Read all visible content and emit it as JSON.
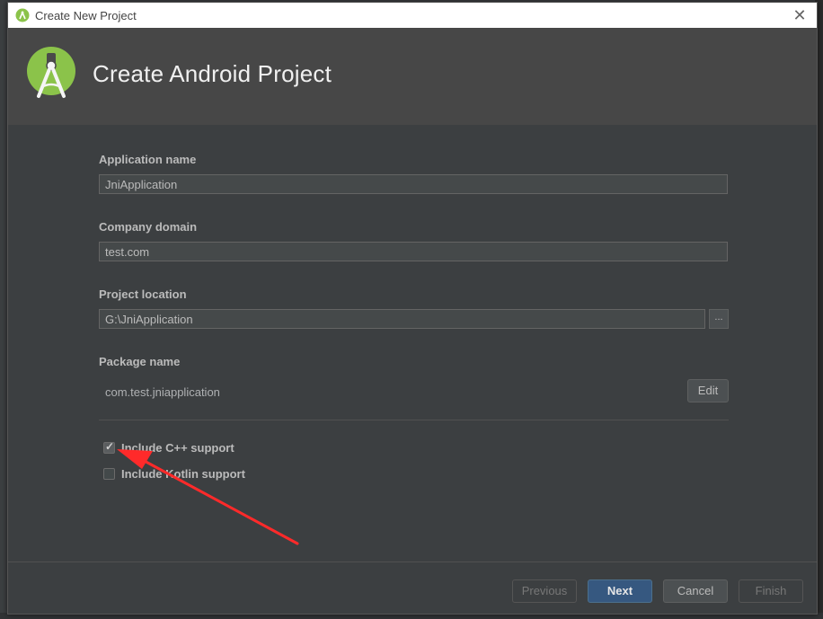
{
  "window": {
    "title": "Create New Project"
  },
  "header": {
    "title": "Create Android Project"
  },
  "form": {
    "app_name_label": "Application name",
    "app_name_value": "JniApplication",
    "company_label": "Company domain",
    "company_value": "test.com",
    "location_label": "Project location",
    "location_value": "G:\\JniApplication",
    "browse_label": "...",
    "package_label": "Package name",
    "package_value": "com.test.jniapplication",
    "edit_label": "Edit",
    "cpp_label": "Include C++ support",
    "cpp_checked": true,
    "kotlin_label": "Include Kotlin support",
    "kotlin_checked": false
  },
  "footer": {
    "previous_label": "Previous",
    "next_label": "Next",
    "cancel_label": "Cancel",
    "finish_label": "Finish"
  },
  "colors": {
    "dialog_bg": "#3c3f41",
    "header_bg": "#474747",
    "android_green": "#8bc34a",
    "annotation_arrow": "#ff2a2a"
  },
  "icons": [
    "android-studio-icon",
    "close-icon",
    "android-studio-logo",
    "checkmark-icon",
    "annotation-arrow"
  ]
}
